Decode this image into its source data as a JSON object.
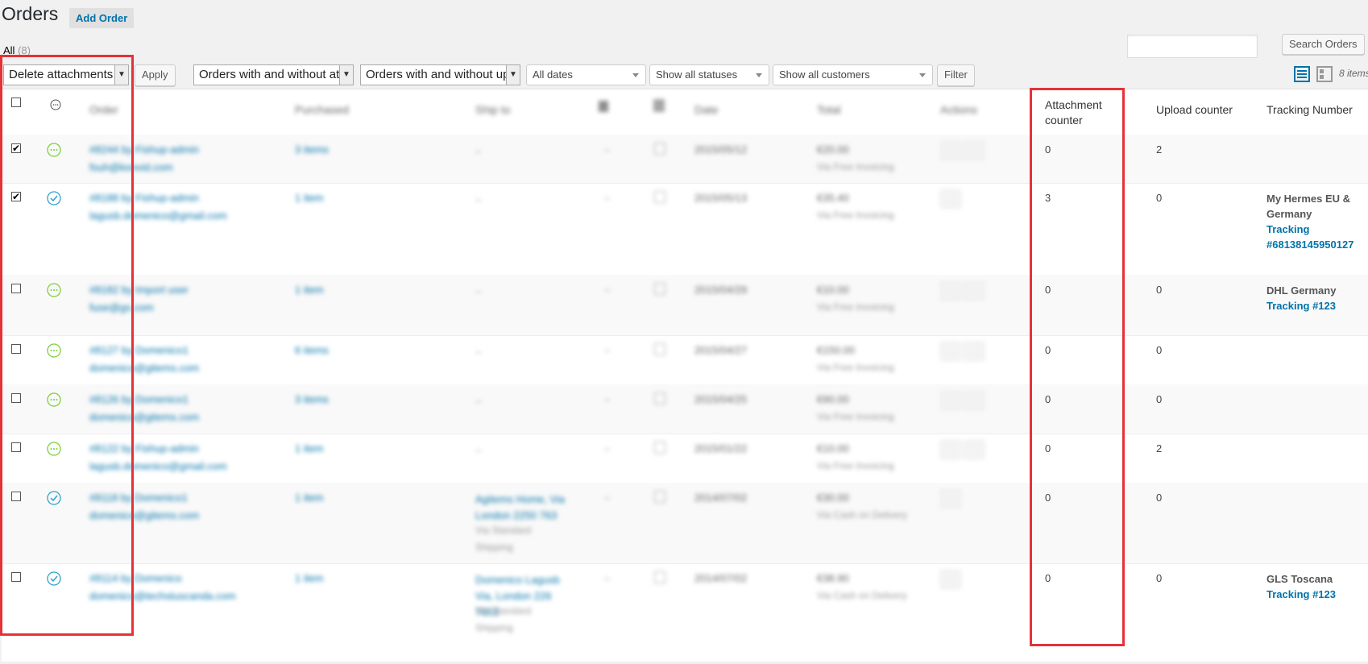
{
  "page": {
    "title": "Orders",
    "add_order_label": "Add Order",
    "filter_all_label": "All",
    "filter_all_count": "(8)"
  },
  "search": {
    "button_label": "Search Orders",
    "value": ""
  },
  "toolbar": {
    "bulk_action_selected": "Delete attachments",
    "apply_label": "Apply",
    "attachments_filter": "Orders with and without at",
    "uploads_filter": "Orders with and without up",
    "dates_filter": "All dates",
    "status_filter": "Show all statuses",
    "customer_filter": "Show all customers",
    "filter_label": "Filter",
    "items_count": "8 items"
  },
  "columns": {
    "order": "Order",
    "purchased": "Purchased",
    "ship_to": "Ship to",
    "date": "Date",
    "total": "Total",
    "actions": "Actions",
    "attachment_counter": "Attachment counter",
    "upload_counter": "Upload counter",
    "tracking_number": "Tracking Number"
  },
  "orders": [
    {
      "checked": true,
      "status": "pending",
      "order_line": "#8244 by Fishup-admin",
      "email": "fsuh@konvid.com",
      "purchased": "3 items",
      "ship_to": "–",
      "ship_method": "",
      "ship_method2": "",
      "date": "2015/05/12",
      "total": "€20.00",
      "total_note": "Via Free Invoicing",
      "attachment_count": "0",
      "upload_count": "2",
      "tracking_carrier": "",
      "tracking_label": ""
    },
    {
      "checked": true,
      "status": "completed",
      "order_line": "#8188 by Fishup-admin",
      "email": "lagusb.domenico@gmail.com",
      "purchased": "1 item",
      "ship_to": "–",
      "ship_method": "",
      "ship_method2": "",
      "date": "2015/05/13",
      "total": "€35.40",
      "total_note": "Via Free Invoicing",
      "attachment_count": "3",
      "upload_count": "0",
      "tracking_carrier": "My Hermes EU & Germany",
      "tracking_label": "Tracking #68138145950127"
    },
    {
      "checked": false,
      "status": "pending",
      "order_line": "#8182 by Import user",
      "email": "fuse@gs.com",
      "purchased": "1 item",
      "ship_to": "–",
      "ship_method": "",
      "ship_method2": "",
      "date": "2015/04/29",
      "total": "€10.00",
      "total_note": "Via Free Invoicing",
      "attachment_count": "0",
      "upload_count": "0",
      "tracking_carrier": "DHL Germany",
      "tracking_label": "Tracking #123"
    },
    {
      "checked": false,
      "status": "pending",
      "order_line": "#8127 by Domenico1",
      "email": "domenico@gitems.com",
      "purchased": "6 items",
      "ship_to": "–",
      "ship_method": "",
      "ship_method2": "",
      "date": "2015/04/27",
      "total": "€150.00",
      "total_note": "Via Free Invoicing",
      "attachment_count": "0",
      "upload_count": "0",
      "tracking_carrier": "",
      "tracking_label": ""
    },
    {
      "checked": false,
      "status": "pending",
      "order_line": "#8126 by Domenico1",
      "email": "domenico@gitems.com",
      "purchased": "3 items",
      "ship_to": "–",
      "ship_method": "",
      "ship_method2": "",
      "date": "2015/04/25",
      "total": "€90.00",
      "total_note": "Via Free Invoicing",
      "attachment_count": "0",
      "upload_count": "0",
      "tracking_carrier": "",
      "tracking_label": ""
    },
    {
      "checked": false,
      "status": "pending",
      "order_line": "#8122 by Fishup-admin",
      "email": "lagusb.domenico@gmail.com",
      "purchased": "1 item",
      "ship_to": "–",
      "ship_method": "",
      "ship_method2": "",
      "date": "2015/01/22",
      "total": "€10.00",
      "total_note": "Via Free Invoicing",
      "attachment_count": "0",
      "upload_count": "2",
      "tracking_carrier": "",
      "tracking_label": ""
    },
    {
      "checked": false,
      "status": "completed",
      "order_line": "#8118 by Domenico1",
      "email": "domenico@gitems.com",
      "purchased": "1 item",
      "ship_to": "Agitems Home, Via London 2250 763",
      "ship_method": "Via Standard",
      "ship_method2": "Shipping",
      "date": "2014/07/02",
      "total": "€30.00",
      "total_note": "Via Cash on Delivery",
      "attachment_count": "0",
      "upload_count": "0",
      "tracking_carrier": "",
      "tracking_label": ""
    },
    {
      "checked": false,
      "status": "completed",
      "order_line": "#8114 by Domenico",
      "email": "domenico@techstuscanda.com",
      "purchased": "1 item",
      "ship_to": "Domenico Lagusb Via, London 226 7653",
      "ship_method": "Via Standard",
      "ship_method2": "Shipping",
      "date": "2014/07/02",
      "total": "€38.90",
      "total_note": "Via Cash on Delivery",
      "attachment_count": "0",
      "upload_count": "0",
      "tracking_carrier": "GLS Toscana",
      "tracking_label": "Tracking #123"
    }
  ],
  "colors": {
    "highlight": "#e53238",
    "link": "#0073aa",
    "pending": "#7ad03a",
    "completed": "#2ea2cc"
  }
}
